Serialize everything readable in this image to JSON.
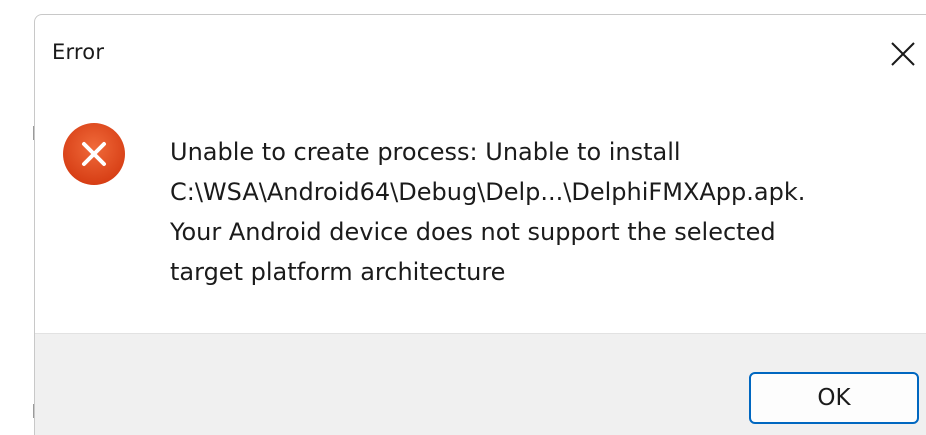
{
  "dialog": {
    "title": "Error",
    "close_icon": "close-icon",
    "status_icon": "error-x-circle-icon",
    "message_lines": [
      "Unable to create process: Unable to install",
      "C:\\WSA\\Android64\\Debug\\Delp...\\DelphiFMXApp.apk.",
      "Your Android device does not support the selected",
      "target platform architecture"
    ],
    "ok_label": "OK"
  },
  "colors": {
    "error_icon": "#e0441c",
    "footer_bg": "#f0f0f0",
    "button_border": "#0067c0"
  }
}
